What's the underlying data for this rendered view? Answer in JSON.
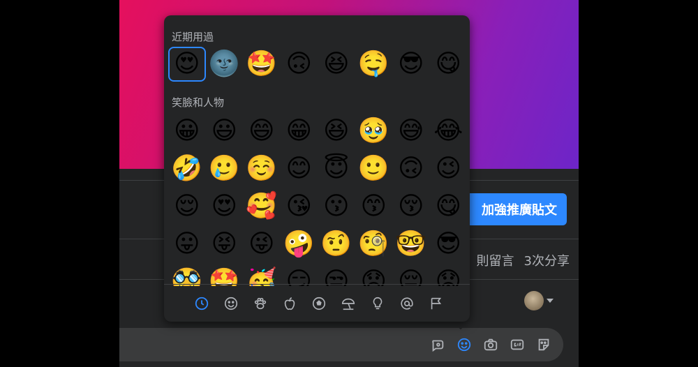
{
  "post": {
    "boost_button": "加強推廣貼文",
    "comments_label": "則留言",
    "shares_label": "3次分享"
  },
  "emoji_picker": {
    "recent_title": "近期用過",
    "recent": [
      "😍",
      "🌚",
      "🤩",
      "🙃",
      "😆",
      "🤤",
      "😎",
      "😋"
    ],
    "smileys_title": "笑臉和人物",
    "smileys": [
      [
        "😀",
        "😃",
        "😄",
        "😁",
        "😆",
        "🥹",
        "😅",
        "😂"
      ],
      [
        "🤣",
        "🥲",
        "☺️",
        "😊",
        "😇",
        "🙂",
        "🙃",
        "😉"
      ],
      [
        "😌",
        "😍",
        "🥰",
        "😘",
        "😗",
        "😙",
        "😚",
        "😋"
      ],
      [
        "😛",
        "😝",
        "😜",
        "🤪",
        "🤨",
        "🧐",
        "🤓",
        "😎"
      ],
      [
        "🥸",
        "🤩",
        "🥳",
        "😏",
        "😒",
        "😞",
        "😔",
        "😟"
      ]
    ],
    "categories": [
      "recent-clock-icon",
      "smiley-icon",
      "paw-icon",
      "apple-icon",
      "soccer-ball-icon",
      "beach-umbrella-icon",
      "lightbulb-icon",
      "at-symbol-icon",
      "flag-icon"
    ]
  },
  "colors": {
    "accent": "#2d88ff",
    "panel": "#242526",
    "muted_text": "#b0b3b8"
  }
}
